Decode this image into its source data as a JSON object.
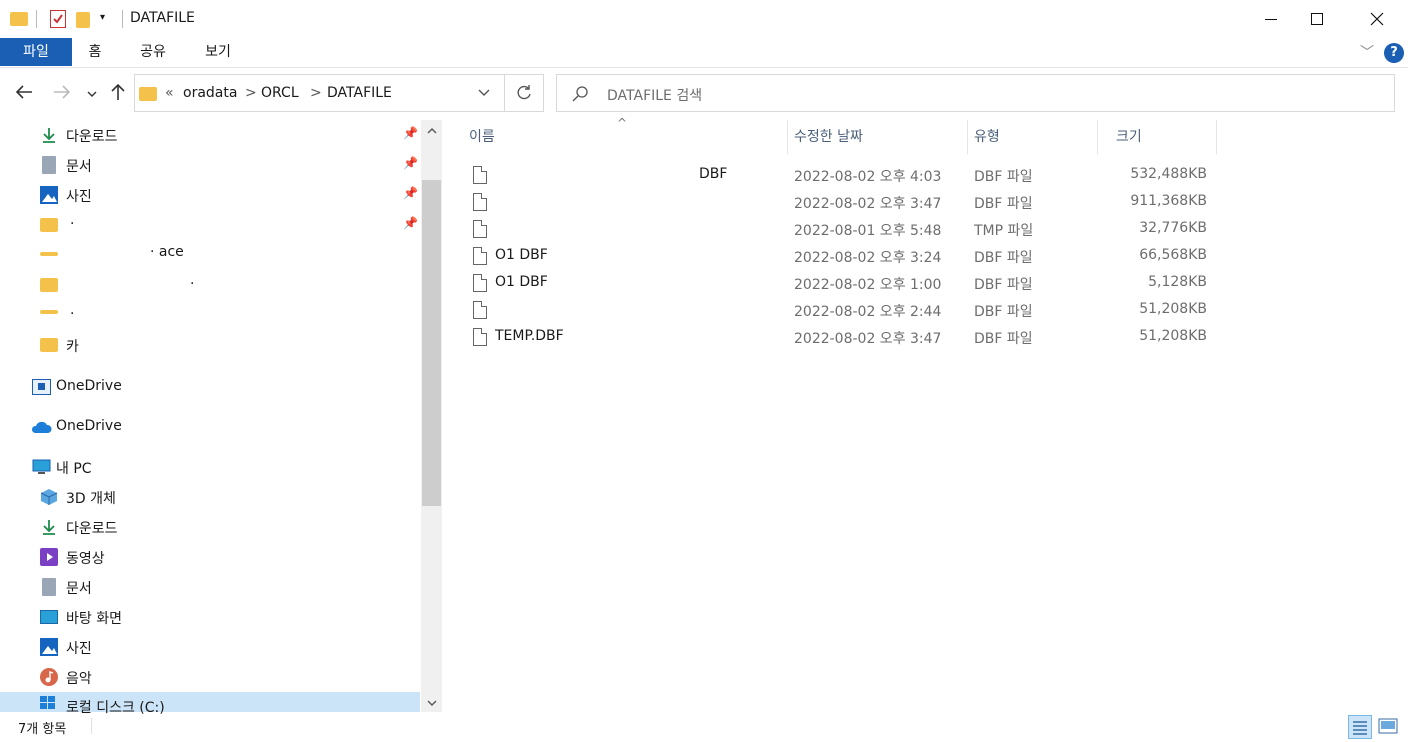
{
  "window": {
    "title": "DATAFILE",
    "minimize_icon": "minimize-icon",
    "maximize_icon": "maximize-icon",
    "close_icon": "close-icon"
  },
  "ribbon": {
    "tabs": [
      {
        "label": "파일",
        "active": true
      },
      {
        "label": "홈",
        "active": false
      },
      {
        "label": "공유",
        "active": false
      },
      {
        "label": "보기",
        "active": false
      }
    ]
  },
  "address": {
    "overflow": "«",
    "crumbs": [
      "oradata",
      "ORCL",
      "DATAFILE"
    ],
    "separator": ">"
  },
  "search": {
    "placeholder": "DATAFILE 검색"
  },
  "sidebar": {
    "quick_access": [
      {
        "label": "다운로드",
        "icon": "download-icon",
        "pinned": true
      },
      {
        "label": "문서",
        "icon": "document-icon",
        "pinned": true
      },
      {
        "label": "사진",
        "icon": "pictures-icon",
        "pinned": true
      },
      {
        "label": "·",
        "icon": "folder-icon",
        "pinned": true
      },
      {
        "label": "· ace",
        "icon": "folder-icon",
        "pinned": false
      },
      {
        "label": "·",
        "icon": "folder-icon",
        "pinned": false
      },
      {
        "label": "·",
        "icon": "folder-icon",
        "pinned": false
      },
      {
        "label": "카",
        "icon": "folder-icon",
        "pinned": false
      }
    ],
    "onedrive1": "OneDrive",
    "onedrive2": "OneDrive",
    "this_pc": "내 PC",
    "pc_items": [
      {
        "label": "3D 개체",
        "icon": "3d-objects-icon"
      },
      {
        "label": "다운로드",
        "icon": "download-icon"
      },
      {
        "label": "동영상",
        "icon": "videos-icon"
      },
      {
        "label": "문서",
        "icon": "document-icon"
      },
      {
        "label": "바탕 화면",
        "icon": "desktop-icon"
      },
      {
        "label": "사진",
        "icon": "pictures-icon"
      },
      {
        "label": "음악",
        "icon": "music-icon"
      },
      {
        "label": "로컬 디스크 (C:)",
        "icon": "drive-icon"
      }
    ]
  },
  "columns": {
    "name": "이름",
    "date": "수정한 날짜",
    "type": "유형",
    "size": "크기"
  },
  "files": [
    {
      "name": "DBF",
      "date": "2022-08-02 오후 4:03",
      "type": "DBF 파일",
      "size": "532,488KB"
    },
    {
      "name": "",
      "date": "2022-08-02 오후 3:47",
      "type": "DBF 파일",
      "size": "911,368KB"
    },
    {
      "name": "",
      "date": "2022-08-01 오후 5:48",
      "type": "TMP 파일",
      "size": "32,776KB"
    },
    {
      "name": "O1 DBF",
      "date": "2022-08-02 오후 3:24",
      "type": "DBF 파일",
      "size": "66,568KB"
    },
    {
      "name": "O1 DBF",
      "date": "2022-08-02 오후 1:00",
      "type": "DBF 파일",
      "size": "5,128KB"
    },
    {
      "name": "",
      "date": "2022-08-02 오후 2:44",
      "type": "DBF 파일",
      "size": "51,208KB"
    },
    {
      "name": "TEMP.DBF",
      "date": "2022-08-02 오후 3:47",
      "type": "DBF 파일",
      "size": "51,208KB"
    }
  ],
  "status": {
    "count": "7개 항목"
  },
  "colors": {
    "accent": "#1a5fb4",
    "folder": "#f4c24a",
    "selection": "#cce4f7"
  }
}
